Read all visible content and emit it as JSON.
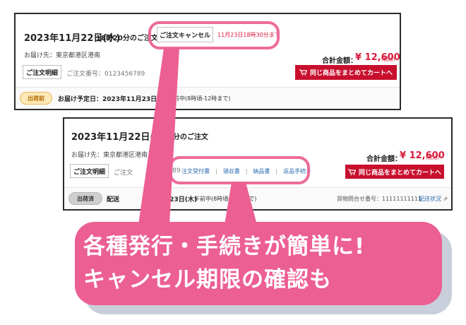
{
  "order1": {
    "date": "2023年11月22日(水)",
    "order_time": "18時20分のご注文",
    "cancel_button": "ご注文キャンセル",
    "cancel_deadline": "11月23日18時30分まで",
    "address": "お届け先：東京都港区港南",
    "detail_button": "ご注文明細",
    "order_number": "ご注文番号：0123456789",
    "total_label": "合計金額：",
    "total_value": "¥ 12,600",
    "tax_label": "(税込)",
    "cart_button": "同じ商品をまとめてカートへ",
    "status_badge": "出荷前",
    "delivery_text": "お届け予定日：2023年11月23日(木)",
    "delivery_time": "前中(8時頃-12時まで)"
  },
  "order2": {
    "date": "2023年11月22日(水)",
    "order_time": "20分のご注文",
    "address": "お届け先：東京都港区港南",
    "detail_button": "ご注文明細",
    "order_number_partial": "ご注文",
    "order_number_tail": "56789",
    "links": [
      "注文受付書",
      "領収書",
      "納品書",
      "返品手続き"
    ],
    "separator": "|",
    "total_label": "合計金額：",
    "total_value": "¥ 12,600",
    "tax_label": "(税込)",
    "cart_button": "同じ商品をまとめてカートへ",
    "status_badge": "出荷済",
    "delivery_prefix": "配送",
    "delivery_date": "1月23日(木)",
    "delivery_time": "午前中(8時頃-12時まで)",
    "tracking": "貨物問合せ番号：11111111111",
    "tracking_link": "配送状況"
  },
  "callout": {
    "line1": "各種発行・手続きが簡単に!",
    "line2": "キャンセル期限の確認も"
  },
  "colors": {
    "accent_pink": "#ec5f93",
    "cart_red": "#c8102e",
    "price_red": "#d81b3c",
    "link_blue": "#2b6cb0"
  }
}
